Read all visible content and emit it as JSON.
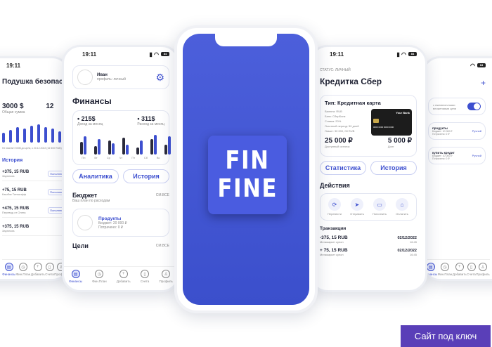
{
  "cushion": {
    "time": "19:11",
    "title": "Подушка безопасности",
    "amount": "3000 $",
    "amount2": "12",
    "sub": "Общая сумма",
    "note": "Не хватает 500$ до цели, к 20.12.2022 (16 500 RUB)",
    "history": "История",
    "tx": [
      {
        "amt": "+375, 15 RUB",
        "cat": "Зарплата",
        "badge": "Пополнение"
      },
      {
        "amt": "+75, 15 RUB",
        "cat": "Кэшбэк Тинькофф",
        "badge": "Пополнение"
      },
      {
        "amt": "+475, 15 RUB",
        "cat": "Перевод от Олега",
        "badge": "Пополнение"
      },
      {
        "amt": "+375, 15 RUB",
        "cat": "Зарплата",
        "badge": ""
      }
    ]
  },
  "finance": {
    "time": "19:11",
    "user": "Иван",
    "plan": "профиль: личный",
    "title": "Финансы",
    "income": "215$",
    "income_label": "Доход за месяц",
    "expense": "311$",
    "expense_label": "Расход за месяц",
    "days": [
      "Пн",
      "Вт",
      "Ср",
      "Чт",
      "Пт",
      "Сб",
      "Вс"
    ],
    "analytics": "Аналитика",
    "history": "История",
    "budget": "Бюджет",
    "budget_sub": "Ваш план по расходам",
    "all": "СМ.ВСЕ",
    "product_title": "Продукты",
    "product_budget": "Бюджет: 20 000 ₽",
    "product_spent": "Потрачено: 0 ₽",
    "goals": "Цели",
    "all2": "СМ.ВСЕ"
  },
  "splash": {
    "line1": "FIN",
    "line2": "FINE"
  },
  "credit": {
    "time": "19:11",
    "status": "СТАТУС: ЛИЧНЫЙ",
    "title": "Кредитка Сбер",
    "type": "Тип: Кредитная карта",
    "details": [
      "Валюта: RUB",
      "Банк: СберБанк",
      "Ставка: 20%",
      "Льготный период: 50 дней",
      "Лимит: 30 000, 00 RUB"
    ],
    "bank": "Your Bank",
    "card_no": "0000 0000 0000 0000",
    "limit": "25 000 ₽",
    "limit_label": "Доступный остаток",
    "debt": "5 000 ₽",
    "debt_label": "Долг",
    "stats": "Статистика",
    "history": "История",
    "actions": "Действия",
    "action_labels": [
      "Перевести",
      "Отправить",
      "Пополнить",
      "Оплатить"
    ],
    "tx_title": "Транзакции",
    "tx": [
      {
        "amt": "-375, 15 RUB",
        "cat": "Мегамаркет купон",
        "date": "02/12/2022",
        "time": "16:45"
      },
      {
        "amt": "+ 75, 15 RUB",
        "cat": "Мегамаркет купон",
        "date": "02/12/2022",
        "time": "16:45"
      }
    ]
  },
  "settings": {
    "time": "19:11",
    "toggle_text": "с ежемесячными вложениями цели",
    "items": [
      {
        "t": "продукты",
        "b": "Бюджет: 10 000 ₽",
        "s": "Потрачено: 0 ₽",
        "link": "Ручной"
      },
      {
        "t": "купить кредит",
        "b": "Бюджет: 10 000 ₽",
        "s": "Потрачено: 0 ₽",
        "link": "Ручной"
      }
    ]
  },
  "tabs": [
    "Финансы",
    "Фин.План",
    "Добавить",
    "Счета",
    "Профиль"
  ],
  "cta": "Сайт под ключ",
  "colors": {
    "accent": "#3d4fcf",
    "cta": "#5a3fb8"
  }
}
